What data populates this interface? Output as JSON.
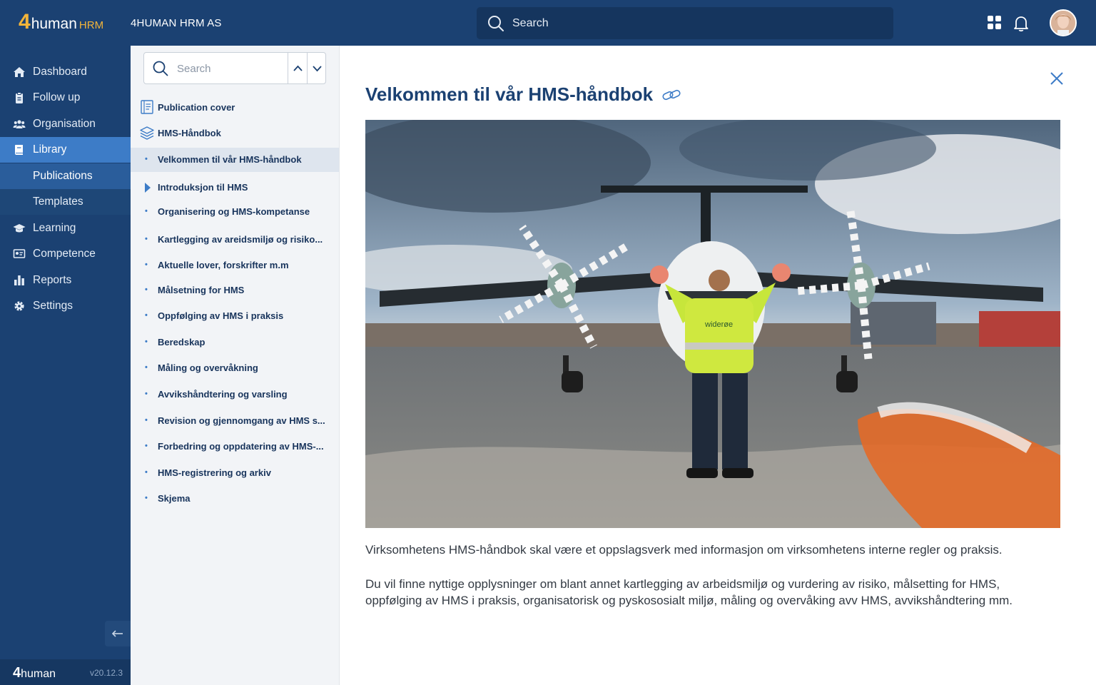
{
  "app": {
    "logo_four": "4",
    "logo_human": "human",
    "logo_hrm": "HRM",
    "company": "4HUMAN HRM AS",
    "search_placeholder": "Search"
  },
  "sidebar": {
    "items": [
      {
        "label": "Dashboard",
        "icon": "home-icon"
      },
      {
        "label": "Follow up",
        "icon": "clipboard-icon"
      },
      {
        "label": "Organisation",
        "icon": "people-icon"
      },
      {
        "label": "Library",
        "icon": "book-icon"
      },
      {
        "label": "Publications"
      },
      {
        "label": "Templates"
      },
      {
        "label": "Learning",
        "icon": "graduation-cap-icon"
      },
      {
        "label": "Competence",
        "icon": "certificate-icon"
      },
      {
        "label": "Reports",
        "icon": "bar-chart-icon"
      },
      {
        "label": "Settings",
        "icon": "gear-icon"
      }
    ],
    "footer_brand_four": "4",
    "footer_brand_human": "human",
    "version": "v20.12.3"
  },
  "tree": {
    "search_placeholder": "Search",
    "cover_label": "Publication cover",
    "book_label": "HMS-Håndbok",
    "chapters": [
      "Velkommen til vår HMS-håndbok",
      "Introduksjon til HMS",
      "Organisering og HMS-kompetanse",
      "Kartlegging av areidsmiljø og risiko...",
      "Aktuelle lover, forskrifter m.m",
      "Målsetning for HMS",
      "Oppfølging av HMS i praksis",
      "Beredskap",
      "Måling og overvåkning",
      "Avvikshåndtering og varsling",
      "Revision og gjennomgang av HMS s...",
      "Forbedring og oppdatering av HMS-...",
      "HMS-registrering og arkiv",
      "Skjema"
    ]
  },
  "content": {
    "title": "Velkommen til vår HMS-håndbok",
    "paragraph1": "Virksomhetens HMS-håndbok skal være et oppslagsverk med informasjon om virksomhetens interne regler og praksis.",
    "paragraph2a": "Du vil finne nyttige opplysninger om blant annet kartlegging av arbeidsmiljø og  vurdering av risiko, målsetting for HMS,",
    "paragraph2b": "oppfølging av  HMS i praksis, organisatorisk og pyskososialt miljø, måling og overvåking avv HMS, avvikshåndtering mm.",
    "photo_vest_text": "widerøe"
  },
  "colors": {
    "nav_bg": "#1b4172",
    "accent": "#3d7cc7",
    "logo_orange": "#f2b43a"
  }
}
